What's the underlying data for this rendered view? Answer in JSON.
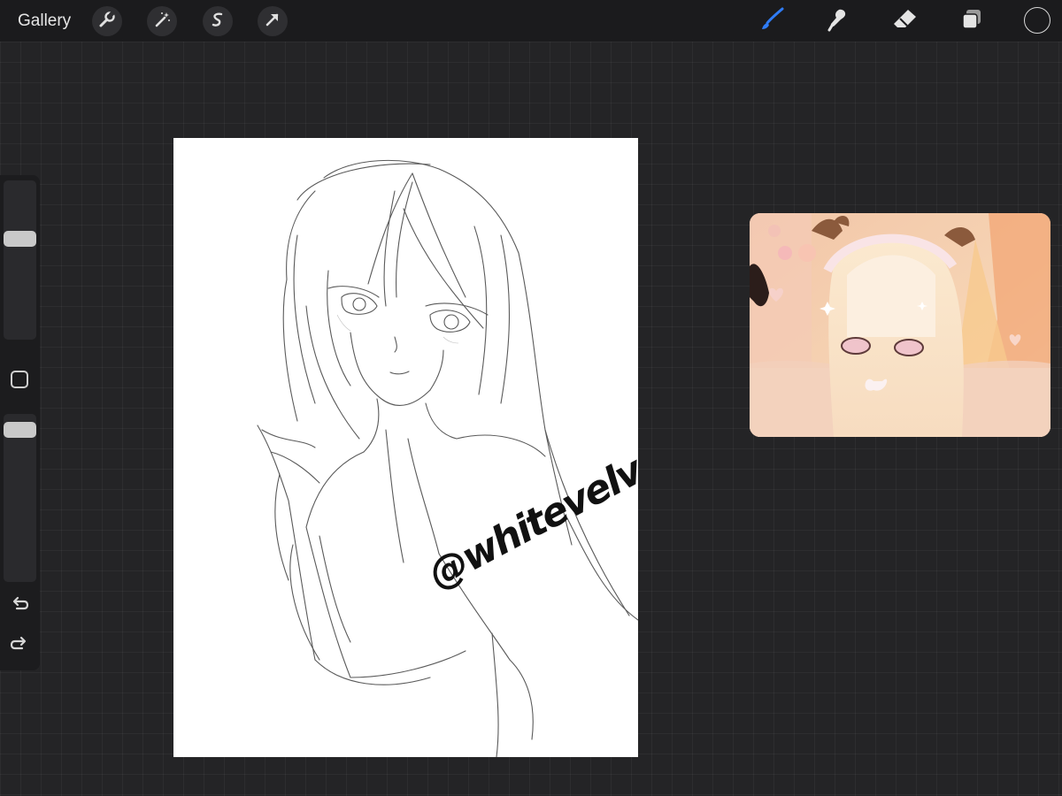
{
  "topbar": {
    "gallery_label": "Gallery",
    "left_tools": [
      {
        "icon": "wrench-icon",
        "name": "actions"
      },
      {
        "icon": "magic-wand-icon",
        "name": "adjustments"
      },
      {
        "icon": "selection-icon",
        "name": "selection"
      },
      {
        "icon": "transform-arrow-icon",
        "name": "transform"
      }
    ],
    "right_tools": [
      {
        "icon": "brush-icon",
        "name": "brush",
        "active": true
      },
      {
        "icon": "smudge-icon",
        "name": "smudge"
      },
      {
        "icon": "eraser-icon",
        "name": "eraser"
      },
      {
        "icon": "layers-icon",
        "name": "layers"
      }
    ],
    "active_color": "#1b1b1d",
    "accent_color": "#2f7cf6"
  },
  "sidebar": {
    "brush_size_level": 0.65,
    "opacity_level": 0.95,
    "modify_icon": "square-icon",
    "undo_icon": "undo-icon",
    "redo_icon": "redo-icon"
  },
  "canvas": {
    "watermark_text": "@whitevelvette"
  },
  "reference": {
    "description_icon": "reference-image"
  }
}
